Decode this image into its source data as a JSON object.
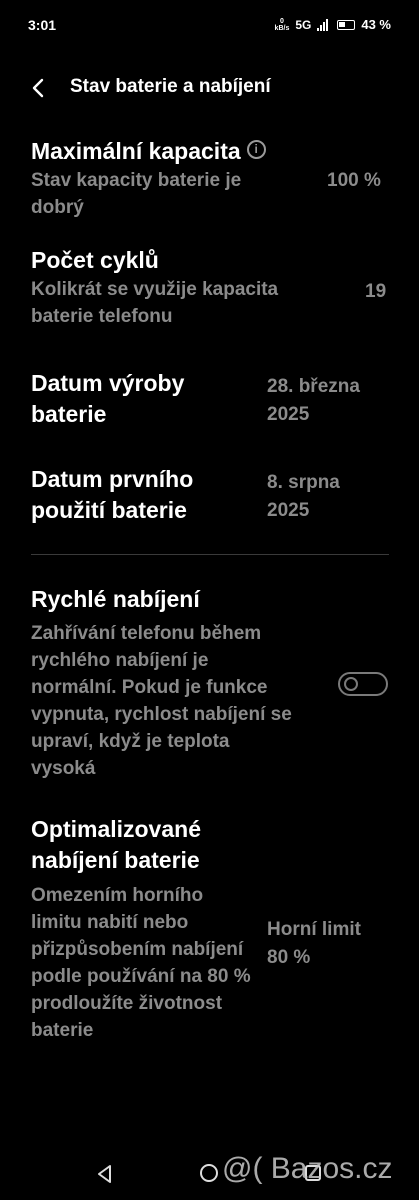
{
  "status_bar": {
    "time": "3:01",
    "speed_value": "0",
    "speed_unit": "kB/s",
    "network": "5G",
    "battery_percent": "43 %"
  },
  "header": {
    "title": "Stav baterie a nabíjení"
  },
  "max_capacity": {
    "title": "Maximální kapacita",
    "info_glyph": "i",
    "description": "Stav kapacity baterie je dobrý",
    "value": "100 %"
  },
  "cycle_count": {
    "title": "Počet cyklů",
    "description": "Kolikrát se využije kapacita baterie telefonu",
    "value": "19"
  },
  "manufacture_date": {
    "title": "Datum výroby baterie",
    "value": "28. března 2025"
  },
  "first_use_date": {
    "title": "Datum prvního použití baterie",
    "value": "8. srpna 2025"
  },
  "fast_charging": {
    "title": "Rychlé nabíjení",
    "description": "Zahřívání telefonu během rychlého nabíjení je normální. Pokud je funkce vypnuta, rychlost nabíjení se upraví, když je teplota vysoká",
    "enabled": false
  },
  "optimized_charging": {
    "title": "Optimalizované nabíjení baterie",
    "description": "Omezením horního limitu nabití nebo přizpůsobením nabíjení podle používání na 80 % prodloužíte životnost baterie",
    "value": "Horní limit 80 %"
  },
  "watermark": "@( Bazos.cz"
}
